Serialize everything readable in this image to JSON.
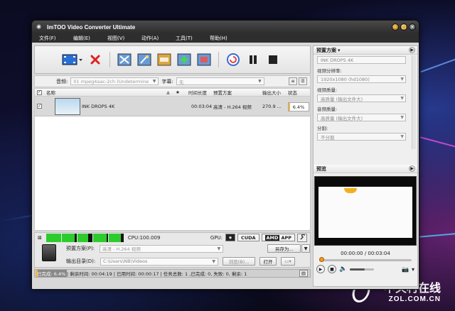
{
  "window": {
    "title": "ImTOO Video Converter Ultimate"
  },
  "menu": [
    "文件(F)",
    "编辑(E)",
    "视图(V)",
    "动作(A)",
    "工具(T)",
    "帮助(H)"
  ],
  "filter": {
    "audio_label": "音频:",
    "audio_value": "01 mpeg4aac-2ch (Undetermine",
    "subtitle_label": "字幕:",
    "subtitle_value": "无"
  },
  "list": {
    "columns": {
      "name": "名称",
      "duration": "时间长度",
      "profile": "预置方案",
      "output_size": "输出大小",
      "status": "状态"
    },
    "rows": [
      {
        "name": "INK DROPS 4K",
        "duration": "00:03:04",
        "profile": "高清 - H.264 视频",
        "size": "270.9 ...",
        "status": "6.4%",
        "progress": 0.064
      }
    ]
  },
  "cpu": {
    "label": "CPU:100.009",
    "core_loads": [
      1.0,
      0.85,
      0.7,
      0.9,
      0.8
    ]
  },
  "gpu": {
    "label": "GPU:",
    "cuda": "CUDA",
    "amd_app": "APP",
    "amd_brand": "AMD"
  },
  "output": {
    "profile_label": "预置方案(P):",
    "profile_value": "高清 - H.264 视频",
    "save_as": "另存为...",
    "dir_label": "输出目录(D):",
    "dir_value": "C:\\Users\\NB\\Videos",
    "browse": "浏览(B)...",
    "open": "打开"
  },
  "status": {
    "progress_text": "已完成: 6.4%",
    "detail": " | 剩余时间: 00:04:19 | 已用时间: 00:00:17 | 任务总数: 1 ,已完成: 0, 失败: 0, 剩余: 1",
    "progress": 0.064
  },
  "right_panel": {
    "profile_header": "预置方案",
    "profile_value": "INK DROPS 4K",
    "video_res_label": "视频分辨率:",
    "video_res_value": "1920x1080 (hd1080)",
    "video_quality_label": "视频质量:",
    "video_quality_value": "高质量 (输出文件大)",
    "audio_quality_label": "音频质量:",
    "audio_quality_value": "高质量 (输出文件大)",
    "split_label": "分割:",
    "split_value": "不分割",
    "preview_header": "预览",
    "time_text": "00:00:00 / 00:03:04",
    "seek_position": 0.0,
    "volume": 0.6
  },
  "watermark": {
    "cn": "中关村在线",
    "en": "ZOL.COM.CN"
  }
}
